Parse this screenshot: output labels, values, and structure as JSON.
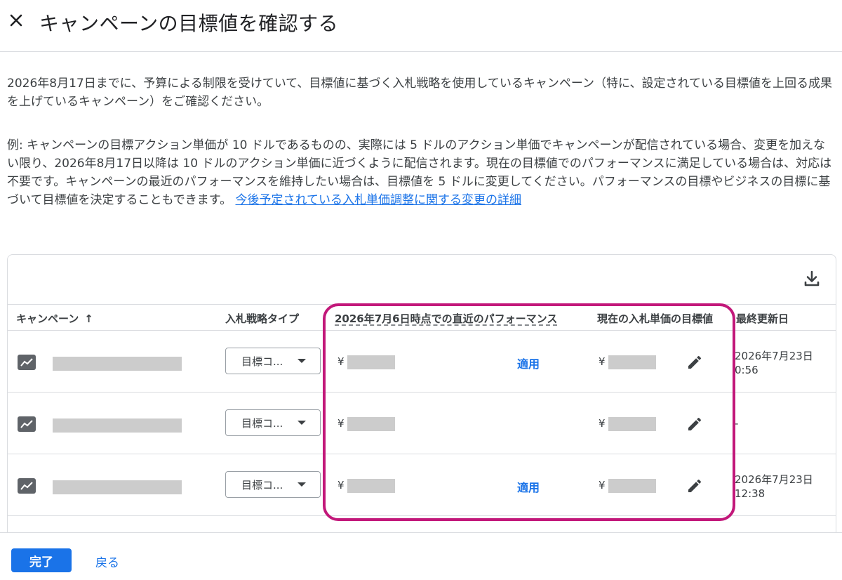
{
  "header": {
    "title": "キャンペーンの目標値を確認する",
    "close_icon": "close-icon"
  },
  "description": {
    "paragraph1": "2026年8月17日までに、予算による制限を受けていて、目標値に基づく入札戦略を使用しているキャンペーン（特に、設定されている目標値を上回る成果を上げているキャンペーン）をご確認ください。",
    "paragraph2": "例: キャンペーンの目標アクション単価が 10 ドルであるものの、実際には 5 ドルのアクション単価でキャンペーンが配信されている場合、変更を加えない限り、2026年8月17日以降は 10 ドルのアクション単価に近づくように配信されます。現在の目標値でのパフォーマンスに満足している場合は、対応は不要です。キャンペーンの最近のパフォーマンスを維持したい場合は、目標値を 5 ドルに変更してください。パフォーマンスの目標やビジネスの目標に基づいて目標値を決定することもできます。",
    "link_text": "今後予定されている入札単価調整に関する変更の詳細"
  },
  "table": {
    "download_icon": "download-icon",
    "columns": {
      "campaign": "キャンペーン",
      "sort_indicator": "↑",
      "strategy": "入札戦略タイプ",
      "performance": "2026年7月6日時点での直近のパフォーマンス",
      "target": "現在の入札単価の目標値",
      "updated": "最終更新日"
    },
    "rows": [
      {
        "strategy": "目標コ...",
        "perf_currency": "¥",
        "apply": "適用",
        "target_currency": "¥",
        "updated_line1": "2026年7月23日",
        "updated_line2": "0:56"
      },
      {
        "strategy": "目標コ...",
        "perf_currency": "¥",
        "apply": "",
        "target_currency": "¥",
        "updated_line1": "-",
        "updated_line2": ""
      },
      {
        "strategy": "目標コ...",
        "perf_currency": "¥",
        "apply": "適用",
        "target_currency": "¥",
        "updated_line1": "2026年7月23日",
        "updated_line2": "12:38"
      }
    ]
  },
  "footer": {
    "done_label": "完了",
    "back_label": "戻る"
  },
  "colors": {
    "accent": "#1a73e8",
    "highlight": "#c2187a",
    "redacted": "#cccccc"
  }
}
